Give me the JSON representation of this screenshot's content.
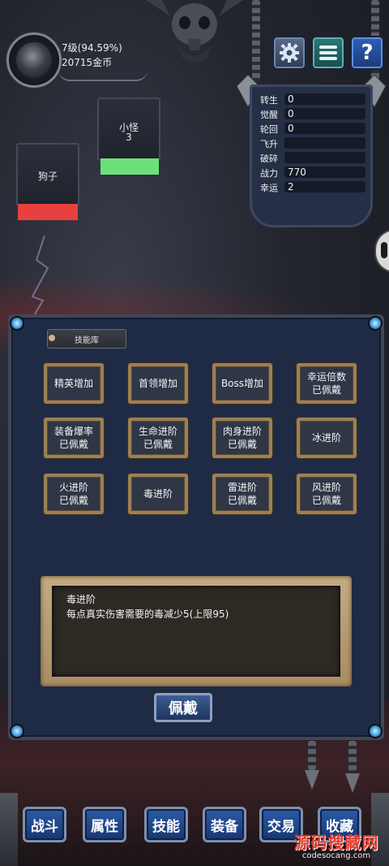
{
  "player": {
    "level": "7级(94.59%)",
    "gold": "20715金币"
  },
  "top_buttons": {
    "settings_icon": "gear-icon",
    "menu_icon": "list-icon",
    "help_label": "?"
  },
  "enemies": [
    {
      "name": "小怪",
      "count": "3",
      "hp_color": "#6de07a"
    },
    {
      "name": "狗子",
      "hp_color": "#e8403f"
    }
  ],
  "stats": [
    {
      "label": "转生",
      "value": "0"
    },
    {
      "label": "觉醒",
      "value": "0"
    },
    {
      "label": "轮回",
      "value": "0"
    },
    {
      "label": "飞升",
      "value": ""
    },
    {
      "label": "破碎",
      "value": ""
    },
    {
      "label": "战力",
      "value": "770"
    },
    {
      "label": "幸运",
      "value": "2"
    }
  ],
  "skill_library": {
    "title": "技能库",
    "skills": [
      {
        "line1": "精英增加",
        "line2": ""
      },
      {
        "line1": "首领增加",
        "line2": ""
      },
      {
        "line1": "Boss增加",
        "line2": ""
      },
      {
        "line1": "幸运倍数",
        "line2": "已佩戴"
      },
      {
        "line1": "装备爆率",
        "line2": "已佩戴"
      },
      {
        "line1": "生命进阶",
        "line2": "已佩戴"
      },
      {
        "line1": "肉身进阶",
        "line2": "已佩戴"
      },
      {
        "line1": "冰进阶",
        "line2": ""
      },
      {
        "line1": "火进阶",
        "line2": "已佩戴"
      },
      {
        "line1": "毒进阶",
        "line2": ""
      },
      {
        "line1": "雷进阶",
        "line2": "已佩戴"
      },
      {
        "line1": "风进阶",
        "line2": "已佩戴"
      }
    ],
    "description": {
      "title": "毒进阶",
      "text": "每点真实伤害需要的毒减少5(上限95)"
    },
    "equip_label": "佩戴"
  },
  "bottom_tabs": [
    "战斗",
    "属性",
    "技能",
    "装备",
    "交易",
    "收藏"
  ],
  "watermark": {
    "main": "源码搜藏网",
    "sub": "codesocang.com"
  },
  "colors": {
    "panel_bg": "#1f2b45",
    "skill_border": "#9b7f57",
    "tab_blue": "#2b5ba7"
  }
}
